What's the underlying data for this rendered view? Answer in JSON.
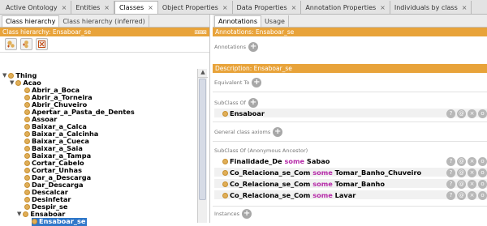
{
  "top_tabs": [
    {
      "label": "Active Ontology",
      "close": "×"
    },
    {
      "label": "Entities",
      "close": "×"
    },
    {
      "label": "Classes",
      "close": "×"
    },
    {
      "label": "Object Properties",
      "close": "×"
    },
    {
      "label": "Data Properties",
      "close": "×"
    },
    {
      "label": "Annotation Properties",
      "close": "×"
    },
    {
      "label": "Individuals by class",
      "close": "×"
    }
  ],
  "left": {
    "tabs": [
      "Class hierarchy",
      "Class hierarchy (inferred)"
    ],
    "header": "Class hierarchy: Ensaboar_se",
    "header_controls": "⊞⊞⊠",
    "tree": [
      {
        "label": "Thing",
        "level": 0,
        "arrow": "▼"
      },
      {
        "label": "Acao",
        "level": 1,
        "arrow": "▼"
      },
      {
        "label": "Abrir_a_Boca",
        "level": 2
      },
      {
        "label": "Abrir_a_Torneira",
        "level": 2
      },
      {
        "label": "Abrir_Chuveiro",
        "level": 2
      },
      {
        "label": "Apertar_a_Pasta_de_Dentes",
        "level": 2
      },
      {
        "label": "Assoar",
        "level": 2
      },
      {
        "label": "Baixar_a_Calca",
        "level": 2
      },
      {
        "label": "Baixar_a_Calcinha",
        "level": 2
      },
      {
        "label": "Baixar_a_Cueca",
        "level": 2
      },
      {
        "label": "Baixar_a_Saia",
        "level": 2
      },
      {
        "label": "Baixar_a_Tampa",
        "level": 2
      },
      {
        "label": "Cortar_Cabelo",
        "level": 2
      },
      {
        "label": "Cortar_Unhas",
        "level": 2
      },
      {
        "label": "Dar_a_Descarga",
        "level": 2
      },
      {
        "label": "Dar_Descarga",
        "level": 2
      },
      {
        "label": "Descalcar",
        "level": 2
      },
      {
        "label": "Desinfetar",
        "level": 2
      },
      {
        "label": "Despir_se",
        "level": 2
      },
      {
        "label": "Ensaboar",
        "level": 2,
        "arrow": "▼"
      },
      {
        "label": "Ensaboar_se",
        "level": 3,
        "selected": true
      }
    ]
  },
  "right": {
    "tabs": [
      "Annotations",
      "Usage"
    ],
    "header": "Annotations: Ensaboar_se",
    "annotations_label": "Annotations",
    "description_header": "Description: Ensaboar_se",
    "equivalent_label": "Equivalent To",
    "subclass_label": "SubClass Of",
    "subclass_items": [
      "Ensaboar"
    ],
    "general_axioms_label": "General class axioms",
    "anon_ancestor_label": "SubClass Of (Anonymous Ancestor)",
    "anon_items": [
      {
        "prop": "Finalidade_De",
        "kw": "some",
        "target": "Sabao"
      },
      {
        "prop": "Co_Relaciona_se_Com",
        "kw": "some",
        "target": "Tomar_Banho_Chuveiro"
      },
      {
        "prop": "Co_Relaciona_se_Com",
        "kw": "some",
        "target": "Tomar_Banho"
      },
      {
        "prop": "Co_Relaciona_se_Com",
        "kw": "some",
        "target": "Lavar"
      }
    ],
    "instances_label": "Instances",
    "row_button_glyphs": [
      "?",
      "@",
      "×",
      "o"
    ]
  },
  "colors": {
    "accent": "#e8a33a",
    "class_dot": "#e0ae58",
    "keyword": "#b62ba9",
    "selection": "#2f77c9"
  }
}
